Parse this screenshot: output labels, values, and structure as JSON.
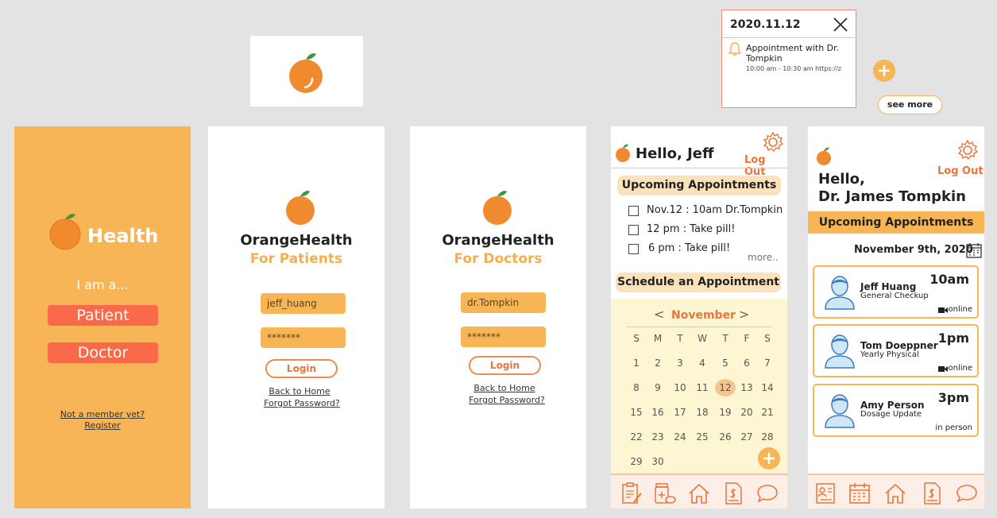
{
  "colors": {
    "orange": "#f7b556",
    "coral": "#fa6a4a",
    "accent": "#e8753a",
    "cream": "#fdf6d2"
  },
  "splash": {
    "app_name": "Health",
    "prompt": "I am a...",
    "patient_label": "Patient",
    "doctor_label": "Doctor",
    "member_link": "Not a member yet?",
    "register_link": "Register"
  },
  "patient_login": {
    "brand": "OrangeHealth",
    "subtitle": "For Patients",
    "username": "jeff_huang",
    "password": "*******",
    "login_label": "Login",
    "back_link": "Back to Home",
    "forgot_link": "Forgot Password?"
  },
  "doctor_login": {
    "brand": "OrangeHealth",
    "subtitle": "For Doctors",
    "username": "dr.Tompkin",
    "password": "*******",
    "login_label": "Login",
    "back_link": "Back to Home",
    "forgot_link": "Forgot Password?"
  },
  "patient_home": {
    "greeting": "Hello, Jeff",
    "logout": "Log Out",
    "upcoming_title": "Upcoming Appointments",
    "items": [
      "Nov.12 : 10am Dr.Tompkin",
      "12 pm : Take pill!",
      "6 pm : Take pill!"
    ],
    "more": "more..",
    "schedule_title": "Schedule an Appointment",
    "calendar": {
      "month": "November",
      "prev": "<",
      "next": ">",
      "weekdays": [
        "S",
        "M",
        "T",
        "W",
        "T",
        "F",
        "S"
      ],
      "weeks": [
        [
          "1",
          "2",
          "3",
          "4",
          "5",
          "6",
          "7"
        ],
        [
          "8",
          "9",
          "10",
          "11",
          "12",
          "13",
          "14"
        ],
        [
          "15",
          "16",
          "17",
          "18",
          "19",
          "20",
          "21"
        ],
        [
          "22",
          "23",
          "24",
          "25",
          "26",
          "27",
          "28"
        ],
        [
          "29",
          "30"
        ]
      ],
      "selected": "12"
    }
  },
  "doctor_home": {
    "greeting_line1": "Hello,",
    "greeting_line2": "Dr. James Tompkin",
    "logout": "Log Out",
    "upcoming_title": "Upcoming Appointments",
    "date": "November 9th, 2020",
    "appointments": [
      {
        "name": "Jeff Huang",
        "type": "General Checkup",
        "time": "10am",
        "mode": "online"
      },
      {
        "name": "Tom Doeppner",
        "type": "Yearly Physical",
        "time": "1pm",
        "mode": "online"
      },
      {
        "name": "Amy Person",
        "type": "Dosage Update",
        "time": "3pm",
        "mode": "in person"
      }
    ]
  },
  "popup": {
    "date": "2020.11.12",
    "title_line1": "Appointment with Dr.",
    "title_line2": "Tompkin",
    "detail": "10:00 am - 10:30 am  https://z"
  },
  "see_more": "see more"
}
